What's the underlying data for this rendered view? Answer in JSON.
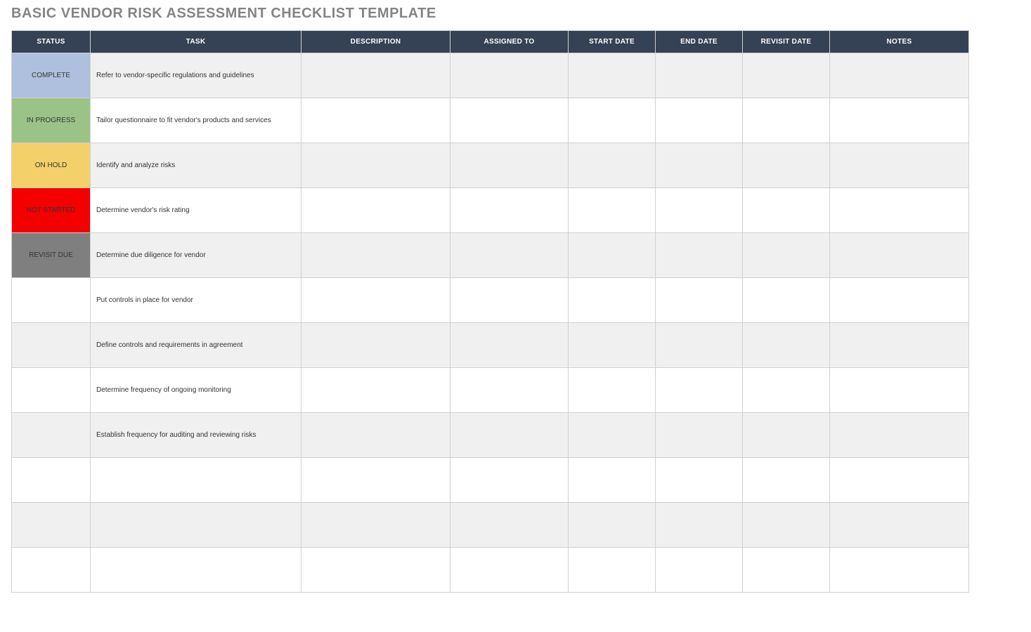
{
  "title": "BASIC VENDOR RISK ASSESSMENT CHECKLIST TEMPLATE",
  "columns": {
    "status": "STATUS",
    "task": "TASK",
    "desc": "DESCRIPTION",
    "assigned": "ASSIGNED TO",
    "start": "START DATE",
    "end": "END DATE",
    "revisit": "REVISIT DATE",
    "notes": "NOTES"
  },
  "status_labels": {
    "complete": "COMPLETE",
    "inprogress": "IN PROGRESS",
    "onhold": "ON HOLD",
    "notstarted": "NOT STARTED",
    "revisitdue": "REVISIT DUE"
  },
  "rows": [
    {
      "status": "complete",
      "task": "Refer to vendor-specific regulations and guidelines",
      "desc": "",
      "assigned": "",
      "start": "",
      "end": "",
      "revisit": "",
      "notes": ""
    },
    {
      "status": "inprogress",
      "task": "Tailor questionnaire to fit vendor's products and services",
      "desc": "",
      "assigned": "",
      "start": "",
      "end": "",
      "revisit": "",
      "notes": ""
    },
    {
      "status": "onhold",
      "task": "Identify and analyze risks",
      "desc": "",
      "assigned": "",
      "start": "",
      "end": "",
      "revisit": "",
      "notes": ""
    },
    {
      "status": "notstarted",
      "task": "Determine vendor's risk rating",
      "desc": "",
      "assigned": "",
      "start": "",
      "end": "",
      "revisit": "",
      "notes": ""
    },
    {
      "status": "revisitdue",
      "task": "Determine due diligence for vendor",
      "desc": "",
      "assigned": "",
      "start": "",
      "end": "",
      "revisit": "",
      "notes": ""
    },
    {
      "status": "",
      "task": "Put controls in place for vendor",
      "desc": "",
      "assigned": "",
      "start": "",
      "end": "",
      "revisit": "",
      "notes": ""
    },
    {
      "status": "",
      "task": "Define controls and requirements in agreement",
      "desc": "",
      "assigned": "",
      "start": "",
      "end": "",
      "revisit": "",
      "notes": ""
    },
    {
      "status": "",
      "task": "Determine frequency of ongoing monitoring",
      "desc": "",
      "assigned": "",
      "start": "",
      "end": "",
      "revisit": "",
      "notes": ""
    },
    {
      "status": "",
      "task": "Establish frequency for auditing and reviewing risks",
      "desc": "",
      "assigned": "",
      "start": "",
      "end": "",
      "revisit": "",
      "notes": ""
    },
    {
      "status": "",
      "task": "",
      "desc": "",
      "assigned": "",
      "start": "",
      "end": "",
      "revisit": "",
      "notes": ""
    },
    {
      "status": "",
      "task": "",
      "desc": "",
      "assigned": "",
      "start": "",
      "end": "",
      "revisit": "",
      "notes": ""
    },
    {
      "status": "",
      "task": "",
      "desc": "",
      "assigned": "",
      "start": "",
      "end": "",
      "revisit": "",
      "notes": ""
    }
  ]
}
